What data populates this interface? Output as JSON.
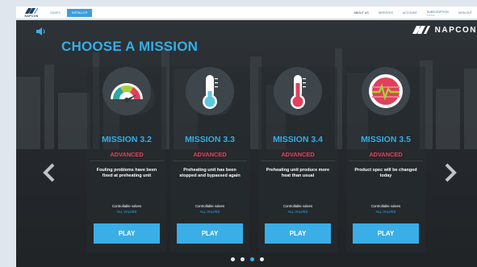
{
  "site": {
    "logo_text": "NAPCON",
    "tabs": [
      {
        "label": "GAMES",
        "active": false
      },
      {
        "label": "INSTALLER",
        "active": true
      }
    ],
    "nav": [
      {
        "label": "ABOUT US"
      },
      {
        "label": "SERVICES"
      },
      {
        "label": "ACCOUNT"
      },
      {
        "label": "Subscription",
        "sub": "status"
      },
      {
        "label": "Sign out"
      }
    ]
  },
  "game": {
    "brand": "NAPCON",
    "title": "CHOOSE A MISSION",
    "speaker_icon": "speaker-icon",
    "prev_icon": "chevron-left-icon",
    "next_icon": "chevron-right-icon",
    "missions": [
      {
        "name": "MISSION 3.2",
        "level": "ADVANCED",
        "icon": "gauge-icon",
        "description": "Fouling problems have been fixed at preheating unit",
        "valves_label": "Controllable valves",
        "valves_value": "ALL VALVES",
        "play_label": "PLAY"
      },
      {
        "name": "MISSION 3.3",
        "level": "ADVANCED",
        "icon": "thermometer-cold-icon",
        "description": "Preheating unit has been stopped and bypassed again",
        "valves_label": "Controllable valves",
        "valves_value": "ALL VALVES",
        "play_label": "PLAY"
      },
      {
        "name": "MISSION 3.4",
        "level": "ADVANCED",
        "icon": "thermometer-hot-icon",
        "description": "Preheating unit produce more heat than usual",
        "valves_label": "Controllable valves",
        "valves_value": "ALL VALVES",
        "play_label": "PLAY"
      },
      {
        "name": "MISSION 3.5",
        "level": "ADVANCED",
        "icon": "signal-wave-icon",
        "description": "Product spec will be changed today",
        "valves_label": "Controllable valves",
        "valves_value": "ALL VALVES",
        "play_label": "PLAY"
      }
    ],
    "pagination": {
      "pages": 4,
      "current": 3
    }
  },
  "colors": {
    "accent": "#33aee8",
    "level": "#e0405a",
    "panel": "#24282c"
  }
}
